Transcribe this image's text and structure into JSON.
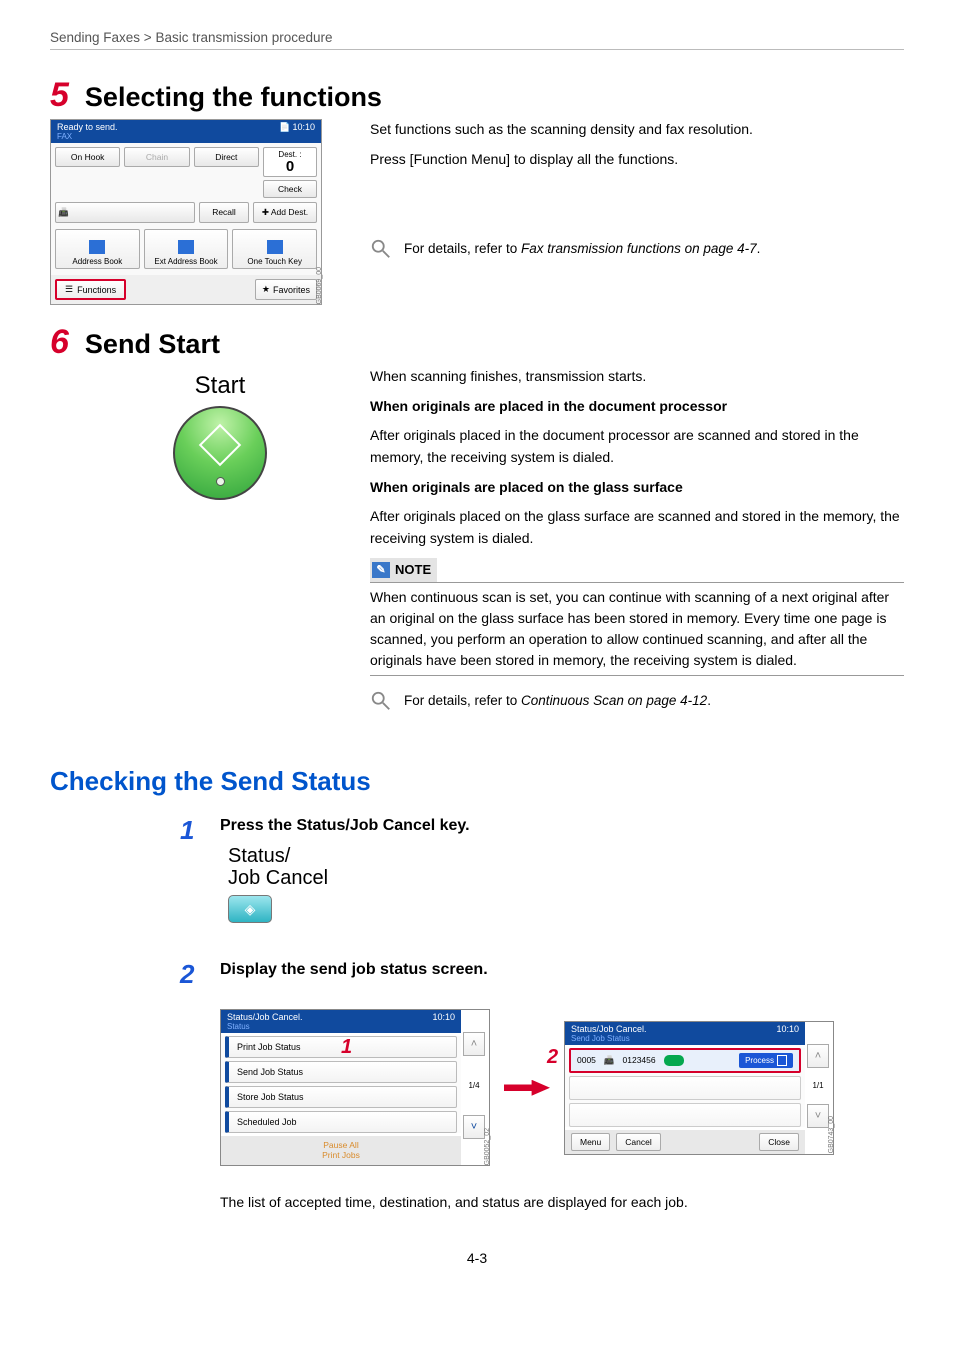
{
  "breadcrumb": "Sending Faxes > Basic transmission procedure",
  "step5": {
    "num": "5",
    "title": "Selecting the functions",
    "p1": "Set functions such as the scanning density and fax resolution.",
    "p2": "Press [Function Menu] to display all the functions.",
    "ref": "For details, refer to ",
    "ref_italic": "Fax transmission functions on page 4-7",
    "ref_dot": "."
  },
  "screen1": {
    "ready": "Ready to send.",
    "time": "10:10",
    "fax": "FAX",
    "dest_label": "Dest. :",
    "dest_count": "0",
    "check": "Check",
    "on_hook": "On Hook",
    "chain": "Chain",
    "direct": "Direct",
    "recall": "Recall",
    "add_dest": "Add Dest.",
    "address_book": "Address Book",
    "ext_ab": "Ext Address Book",
    "otk": "One Touch Key",
    "functions": "Functions",
    "favorites": "Favorites",
    "ref": "GB0069_00"
  },
  "step6": {
    "num": "6",
    "title": "Send Start",
    "start_label": "Start",
    "p1": "When scanning finishes, transmission starts.",
    "h1": "When originals are placed in the document processor",
    "p2": "After originals placed in the document processor are scanned and stored in the memory, the receiving system is dialed.",
    "h2": "When originals are placed on the glass surface",
    "p3": "After originals placed on the glass surface are scanned and stored in the memory, the receiving system is dialed.",
    "note_label": "NOTE",
    "note_body": "When continuous scan is set, you can continue with scanning of a next original after an original on the glass surface has been stored in memory. Every time one page is scanned, you perform an operation to allow continued scanning, and after all the originals have been stored in memory, the receiving system is dialed.",
    "ref": "For details, refer to ",
    "ref_italic": "Continuous Scan on page 4-12",
    "ref_dot": "."
  },
  "section2": {
    "title": "Checking the Send Status",
    "sub1_num": "1",
    "sub1_title": "Press the Status/Job Cancel key.",
    "key_label1": "Status/",
    "key_label2": "Job Cancel",
    "sub2_num": "2",
    "sub2_title": "Display the send job status screen.",
    "caption": "The list of accepted time, destination, and status are displayed for each job."
  },
  "screenA": {
    "title": "Status/Job Cancel.",
    "sub": "Status",
    "time": "10:10",
    "items": [
      "Print Job Status",
      "Send Job Status",
      "Store Job Status",
      "Scheduled Job"
    ],
    "page": "1/4",
    "pause1": "Pause All",
    "pause2": "Print Jobs",
    "ref": "GB0052_02",
    "mark": "1"
  },
  "screenB": {
    "title": "Status/Job Cancel.",
    "sub": "Send Job Status",
    "time": "10:10",
    "job_no": "0005",
    "dest": "0123456",
    "process": "Process",
    "page": "1/1",
    "menu": "Menu",
    "cancel": "Cancel",
    "close": "Close",
    "ref": "GB0743_00",
    "mark": "2"
  },
  "page_number": "4-3"
}
